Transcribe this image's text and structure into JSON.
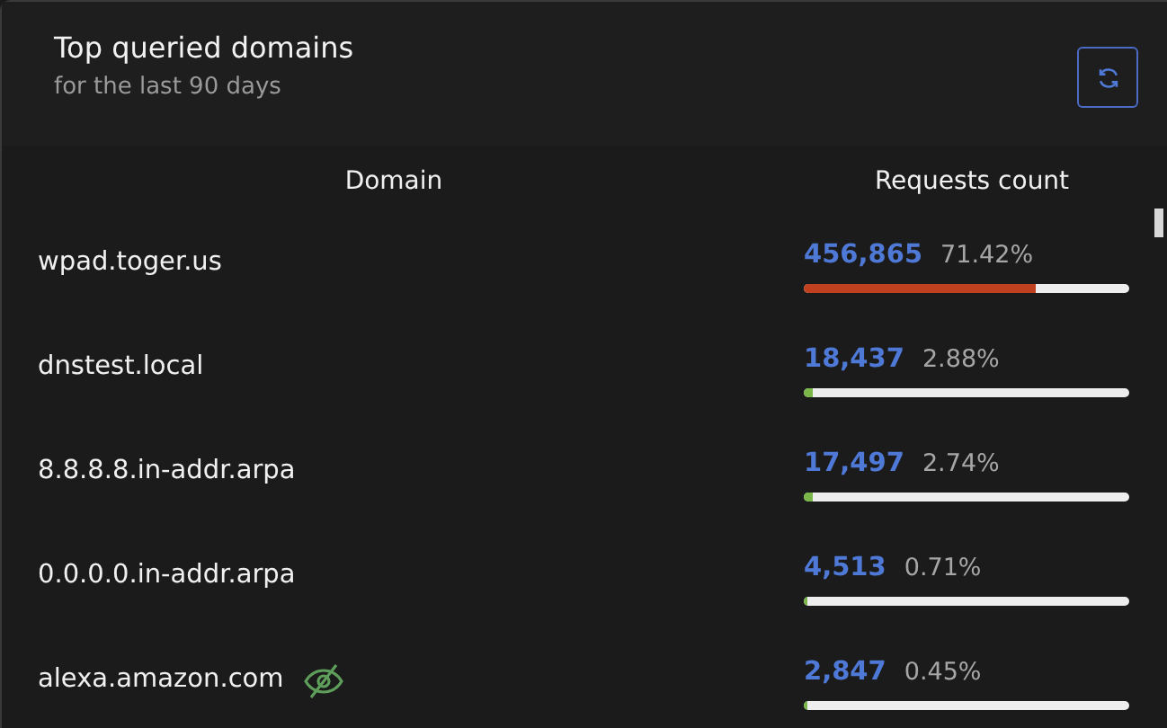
{
  "card": {
    "title": "Top queried domains",
    "subtitle": "for the last 90 days"
  },
  "table": {
    "columns": [
      "Domain",
      "Requests count"
    ],
    "rows": [
      {
        "domain": "wpad.toger.us",
        "hidden": false,
        "count": "456,865",
        "percent": "71.42%",
        "level": 0.7142,
        "color": "#c1401f"
      },
      {
        "domain": "dnstest.local",
        "hidden": false,
        "count": "18,437",
        "percent": "2.88%",
        "level": 0.0288,
        "color": "#7ab648"
      },
      {
        "domain": "8.8.8.8.in-addr.arpa",
        "hidden": false,
        "count": "17,497",
        "percent": "2.74%",
        "level": 0.0274,
        "color": "#7ab648"
      },
      {
        "domain": "0.0.0.0.in-addr.arpa",
        "hidden": false,
        "count": "4,513",
        "percent": "0.71%",
        "level": 0.0071,
        "color": "#7ab648"
      },
      {
        "domain": "alexa.amazon.com",
        "hidden": true,
        "count": "2,847",
        "percent": "0.45%",
        "level": 0.0045,
        "color": "#7ab648"
      }
    ]
  }
}
